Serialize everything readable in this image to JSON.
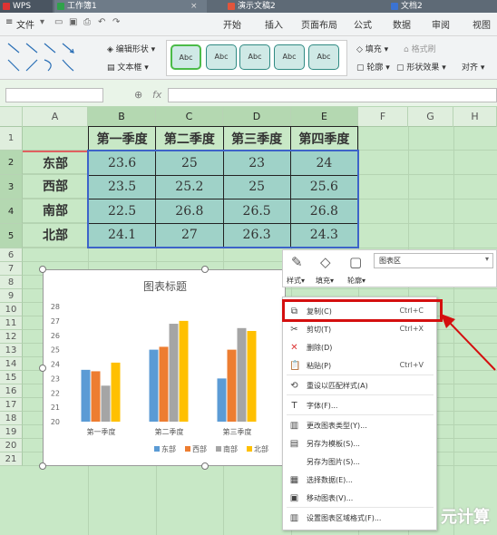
{
  "titlebar": {
    "app": "WPS",
    "tabs": [
      {
        "label": "工作簿1"
      },
      {
        "label": "演示文稿2"
      },
      {
        "label": "文档2"
      }
    ]
  },
  "menubar": {
    "file": "文件",
    "items": [
      "开始",
      "插入",
      "页面布局",
      "公式",
      "数据",
      "审阅",
      "视图"
    ]
  },
  "ribbon": {
    "edit_shape": "编辑形状",
    "textbox": "文本框",
    "style_label": "Abc",
    "fill": "填充",
    "format_brush": "格式刷",
    "outline": "轮廓",
    "shape_effect": "形状效果",
    "align": "对齐"
  },
  "formula": {
    "fx": "fx"
  },
  "columns": [
    "A",
    "B",
    "C",
    "D",
    "E",
    "F",
    "G",
    "H"
  ],
  "rows": [
    "1",
    "2",
    "3",
    "4",
    "5",
    "6",
    "7",
    "8",
    "9",
    "10",
    "11",
    "12",
    "13",
    "14",
    "15",
    "16",
    "17",
    "18",
    "19",
    "20",
    "21"
  ],
  "table": {
    "headers": [
      "第一季度",
      "第二季度",
      "第三季度",
      "第四季度"
    ],
    "regions": [
      "东部",
      "西部",
      "南部",
      "北部"
    ],
    "values": [
      [
        "23.6",
        "25",
        "23",
        "24"
      ],
      [
        "23.5",
        "25.2",
        "25",
        "25.6"
      ],
      [
        "22.5",
        "26.8",
        "26.5",
        "26.8"
      ],
      [
        "24.1",
        "27",
        "26.3",
        "24.3"
      ]
    ]
  },
  "chart_data": {
    "type": "bar",
    "title": "图表标题",
    "categories": [
      "第一季度",
      "第二季度",
      "第三季度"
    ],
    "yticks": [
      "20",
      "21",
      "22",
      "23",
      "24",
      "25",
      "26",
      "27",
      "28"
    ],
    "ylim": [
      20,
      28
    ],
    "series": [
      {
        "name": "东部",
        "color": "#5b9bd5",
        "values": [
          23.6,
          25,
          23
        ]
      },
      {
        "name": "西部",
        "color": "#ed7d31",
        "values": [
          23.5,
          25.2,
          25
        ]
      },
      {
        "name": "南部",
        "color": "#a5a5a5",
        "values": [
          22.5,
          26.8,
          26.5
        ]
      },
      {
        "name": "北部",
        "color": "#ffc000",
        "values": [
          24.1,
          27,
          26.3
        ]
      }
    ],
    "legend": "bottom"
  },
  "minibar": {
    "style": "样式",
    "fill": "填充",
    "outline": "轮廓",
    "dropdown": "图表区"
  },
  "context_menu": [
    {
      "label": "复制(C)",
      "key": "Ctrl+C",
      "icon": "copy-icon",
      "glyph": "⧉"
    },
    {
      "label": "剪切(T)",
      "key": "Ctrl+X",
      "icon": "cut-icon",
      "glyph": "✂"
    },
    {
      "label": "删除(D)",
      "key": "",
      "icon": "delete-icon",
      "glyph": "✕"
    },
    {
      "label": "粘贴(P)",
      "key": "Ctrl+V",
      "icon": "paste-icon",
      "glyph": "📋"
    },
    {
      "label": "重设以匹配样式(A)",
      "key": "",
      "icon": "reset-icon",
      "glyph": "⟲"
    },
    {
      "label": "字体(F)...",
      "key": "",
      "icon": "font-icon",
      "glyph": "T"
    },
    {
      "label": "更改图表类型(Y)...",
      "key": "",
      "icon": "chart-type-icon",
      "glyph": "▥"
    },
    {
      "label": "另存为模板(S)...",
      "key": "",
      "icon": "save-template-icon",
      "glyph": "▤"
    },
    {
      "label": "另存为图片(S)...",
      "key": "",
      "icon": "save-image-icon",
      "glyph": ""
    },
    {
      "label": "选择数据(E)...",
      "key": "",
      "icon": "select-data-icon",
      "glyph": "▦"
    },
    {
      "label": "移动图表(V)...",
      "key": "",
      "icon": "move-chart-icon",
      "glyph": "▣"
    },
    {
      "label": "设置图表区域格式(F)...",
      "key": "",
      "icon": "format-area-icon",
      "glyph": "▥"
    }
  ],
  "watermark": "元计算"
}
